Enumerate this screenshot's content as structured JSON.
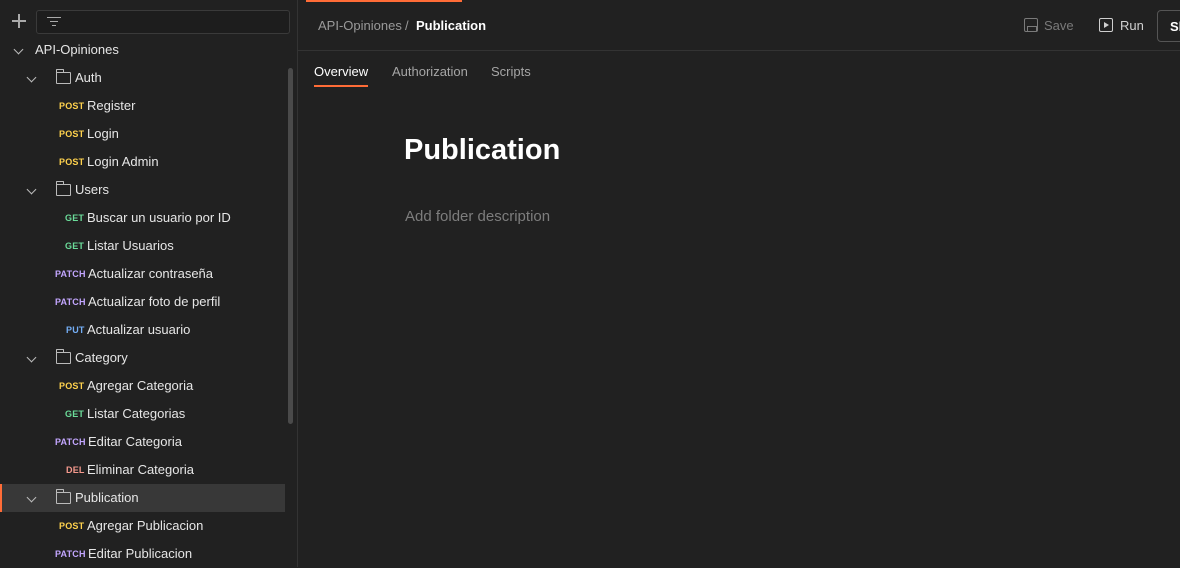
{
  "breadcrumb": {
    "parent": "API-Opiniones",
    "separator": "/",
    "current": "Publication"
  },
  "toolbar": {
    "save_label": "Save",
    "run_label": "Run",
    "share_label": "Sh"
  },
  "tabs": [
    {
      "label": "Overview",
      "active": true
    },
    {
      "label": "Authorization",
      "active": false
    },
    {
      "label": "Scripts",
      "active": false
    }
  ],
  "main": {
    "title": "Publication",
    "description_placeholder": "Add folder description"
  },
  "colors": {
    "accent": "#ff6c37",
    "post": "#ffd24d",
    "get": "#6bdd9a",
    "patch": "#c3a6ff",
    "put": "#74aef6",
    "del": "#f79a8e"
  },
  "sidebar": {
    "collection": "API-Opiniones",
    "folders": {
      "auth": {
        "name": "Auth",
        "requests": [
          {
            "method": "POST",
            "name": "Register"
          },
          {
            "method": "POST",
            "name": "Login"
          },
          {
            "method": "POST",
            "name": "Login Admin"
          }
        ]
      },
      "users": {
        "name": "Users",
        "requests": [
          {
            "method": "GET",
            "name": "Buscar un usuario por ID"
          },
          {
            "method": "GET",
            "name": "Listar Usuarios"
          },
          {
            "method": "PATCH",
            "name": "Actualizar contraseña"
          },
          {
            "method": "PATCH",
            "name": "Actualizar foto de perfil"
          },
          {
            "method": "PUT",
            "name": "Actualizar usuario"
          }
        ]
      },
      "category": {
        "name": "Category",
        "requests": [
          {
            "method": "POST",
            "name": "Agregar Categoria"
          },
          {
            "method": "GET",
            "name": "Listar Categorias"
          },
          {
            "method": "PATCH",
            "name": "Editar Categoria"
          },
          {
            "method": "DEL",
            "name": "Eliminar Categoria"
          }
        ]
      },
      "publication": {
        "name": "Publication",
        "selected": true,
        "requests": [
          {
            "method": "POST",
            "name": "Agregar Publicacion"
          },
          {
            "method": "PATCH",
            "name": "Editar Publicacion"
          }
        ]
      }
    }
  }
}
